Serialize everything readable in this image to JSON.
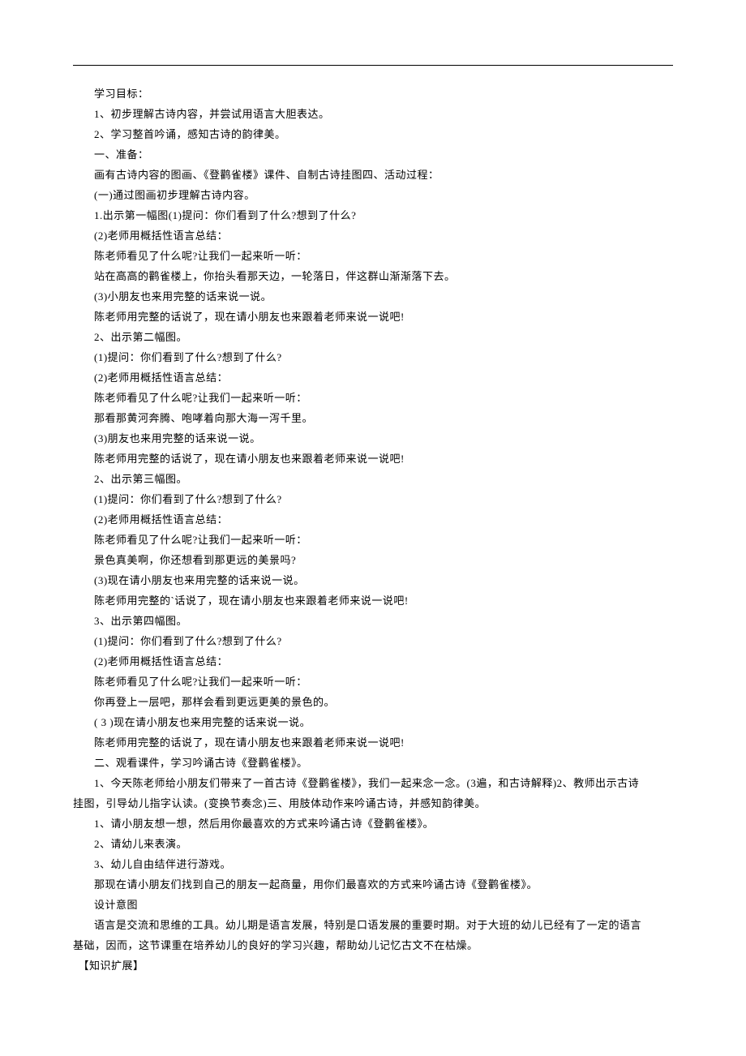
{
  "lines": [
    "学习目标：",
    "1、初步理解古诗内容，并尝试用语言大胆表达。",
    "2、学习整首吟诵，感知古诗的韵律美。",
    "一、准备：",
    "画有古诗内容的图画、《登鹳雀楼》课件、自制古诗挂图四、活动过程：",
    "(一)通过图画初步理解古诗内容。",
    "1.出示第一幅图(1)提问：你们看到了什么?想到了什么?",
    "(2)老师用概括性语言总结：",
    "陈老师看见了什么呢?让我们一起来听一听：",
    "站在高高的鹳雀楼上，你抬头看那天边，一轮落日，伴这群山渐渐落下去。",
    "(3)小朋友也来用完整的话来说一说。",
    "陈老师用完整的话说了，现在请小朋友也来跟着老师来说一说吧!",
    "2、出示第二幅图。",
    "(1)提问：你们看到了什么?想到了什么?",
    "(2)老师用概括性语言总结：",
    "陈老师看见了什么呢?让我们一起来听一听：",
    "那看那黄河奔腾、咆哮着向那大海一泻千里。",
    "(3)朋友也来用完整的话来说一说。",
    "陈老师用完整的话说了，现在请小朋友也来跟着老师来说一说吧!",
    "2、出示第三幅图。",
    "(1)提问：你们看到了什么?想到了什么?",
    "(2)老师用概括性语言总结：",
    "陈老师看见了什么呢?让我们一起来听一听：",
    "景色真美啊，你还想看到那更远的美景吗?",
    "(3)现在请小朋友也来用完整的话来说一说。",
    "陈老师用完整的`话说了，现在请小朋友也来跟着老师来说一说吧!",
    "3、出示第四幅图。",
    "(1)提问：你们看到了什么?想到了什么?",
    "(2)老师用概括性语言总结：",
    "陈老师看见了什么呢?让我们一起来听一听：",
    "你再登上一层吧，那样会看到更远更美的景色的。",
    "( 3 )现在请小朋友也来用完整的话来说一说。",
    "陈老师用完整的话说了，现在请小朋友也来跟着老师来说一说吧!",
    "二、观看课件，学习吟诵古诗《登鹳雀楼》。",
    "1、今天陈老师给小朋友们带来了一首古诗《登鹳雀楼》，我们一起来念一念。(3遍，和古诗解释)2、教师出示古诗",
    "挂图，引导幼儿指字认读。(变换节奏念)三、用肢体动作来吟诵古诗，并感知韵律美。",
    "1、请小朋友想一想，然后用你最喜欢的方式来吟诵古诗《登鹳雀楼》。",
    "2、请幼儿来表演。",
    "3、幼儿自由结伴进行游戏。",
    "那现在请小朋友们找到自己的朋友一起商量，用你们最喜欢的方式来吟诵古诗《登鹳雀楼》。",
    "设计意图",
    "语言是交流和思维的工具。幼儿期是语言发展，特别是口语发展的重要时期。对于大班的幼儿已经有了一定的语言",
    "基础，因而，这节课重在培养幼儿的良好的学习兴趣，帮助幼儿记忆古文不在枯燥。"
  ],
  "knowledge_tag": "【知识扩展】"
}
